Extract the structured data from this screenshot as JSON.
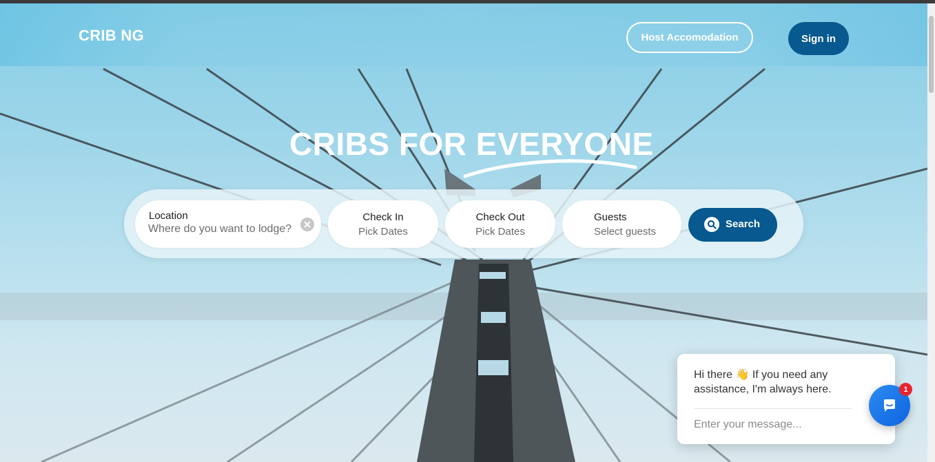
{
  "nav": {
    "brand": "CRIB NG",
    "host_label": "Host Accomodation",
    "signin_label": "Sign in"
  },
  "hero": {
    "title": "CRIBS FOR EVERYONE"
  },
  "search": {
    "location_label": "Location",
    "location_placeholder": "Where do you want to lodge?",
    "checkin_label": "Check In",
    "checkin_value": "Pick Dates",
    "checkout_label": "Check Out",
    "checkout_value": "Pick Dates",
    "guests_label": "Guests",
    "guests_value": "Select guests",
    "button_label": "Search"
  },
  "chat": {
    "greeting": "Hi there 👋 If you need any assistance, I'm always here.",
    "input_placeholder": "Enter your message...",
    "unread_count": "1"
  },
  "icons": {
    "clear": "close-circle-icon",
    "search": "search-icon",
    "chat": "chat-bubble-icon"
  },
  "colors": {
    "primary": "#07598f",
    "chat_blue": "#1a73e8",
    "badge_red": "#e8232f"
  }
}
